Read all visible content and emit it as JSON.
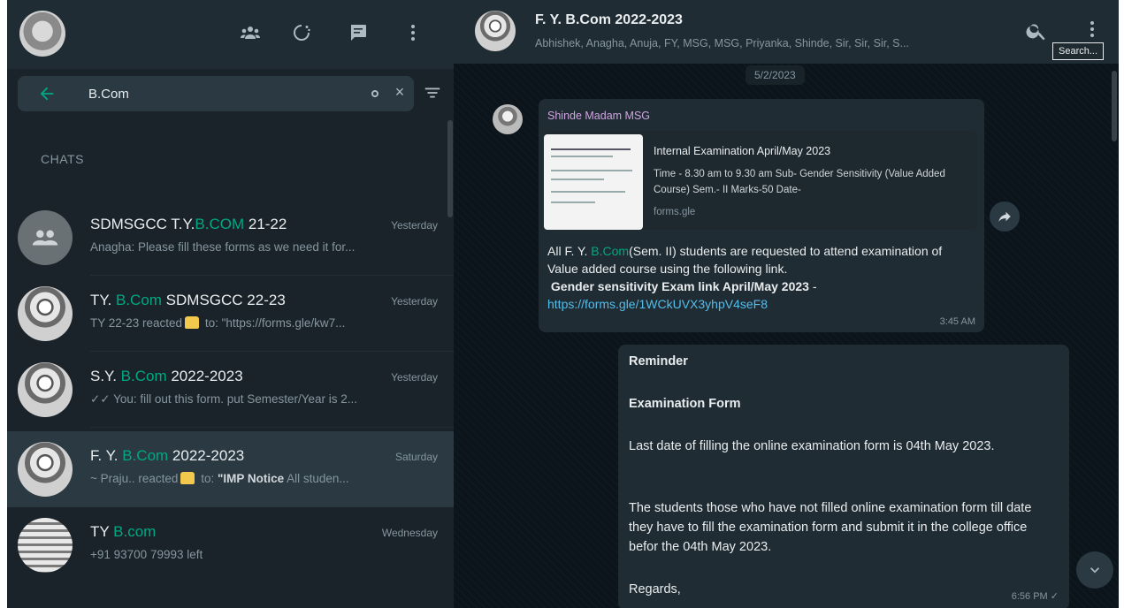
{
  "left_header": {
    "icons": [
      "communities-icon",
      "status-icon",
      "new-chat-icon",
      "menu-icon"
    ]
  },
  "search": {
    "value": "B.Com",
    "clear": "×"
  },
  "section": {
    "chats_label": "CHATS"
  },
  "chats": [
    {
      "title_pre": "SDMSGCC T.Y.",
      "title_hl": "B.COM",
      "title_post": " 21-22",
      "time": "Yesterday",
      "preview": "Anagha: Please fill these forms as we need it for..."
    },
    {
      "title_pre": "TY. ",
      "title_hl": "B.Com",
      "title_post": " SDMSGCC 22-23",
      "time": "Yesterday",
      "preview_pre": "TY 22-23 reacted",
      "preview_post": " to: \"https://forms.gle/kw7..."
    },
    {
      "title_pre": "S.Y. ",
      "title_hl": "B.Com",
      "title_post": " 2022-2023",
      "time": "Yesterday",
      "preview": "✓✓ You: fill out this form. put Semester/Year is 2..."
    },
    {
      "title_pre": "F. Y. ",
      "title_hl": "B.Com",
      "title_post": " 2022-2023",
      "time": "Saturday",
      "preview_pre": "~ Praju.. reacted",
      "preview_mid": " to: ",
      "preview_bold": "\"IMP Notice",
      "preview_post": " All studen..."
    },
    {
      "title_pre": "TY ",
      "title_hl": "B.com",
      "title_post": "",
      "time": "Wednesday",
      "preview": "+91 93700 79993 left"
    }
  ],
  "conversation": {
    "title": "F. Y. B.Com 2022-2023",
    "members": "Abhishek, Anagha, Anuja, FY, MSG, MSG, Priyanka, Shinde, Sir, Sir, Sir, S...",
    "tooltip": "Search...",
    "date_chip": "5/2/2023"
  },
  "message_in": {
    "sender": "Shinde Madam MSG",
    "link_title": "Internal Examination April/May 2023",
    "link_desc": "Time - 8.30 am to 9.30 am Sub- Gender Sensitivity (Value Added Course) Sem.- II Marks-50 Date-",
    "link_domain": "forms.gle",
    "body_pre": "All F. Y. ",
    "body_hl": "B.Com",
    "body_post": "(Sem. II) students are requested to attend examination of Value added course using the following link.",
    "body_bold": "Gender sensitivity Exam link April/May 2023",
    "body_dash": " -",
    "url": "https://forms.gle/1WCkUVX3yhpV4seF8",
    "time": "3:45 AM"
  },
  "message_out": {
    "line1": "Reminder",
    "line2": "Examination Form",
    "line3": "Last date of filling the online examination form is 04th May 2023.",
    "line4": "The students those who have not filled online examination form till date they have to fill the examination form and submit it in the college office befor the 04th May 2023.",
    "line5": "Regards,",
    "time": "6:56 PM ✓"
  }
}
